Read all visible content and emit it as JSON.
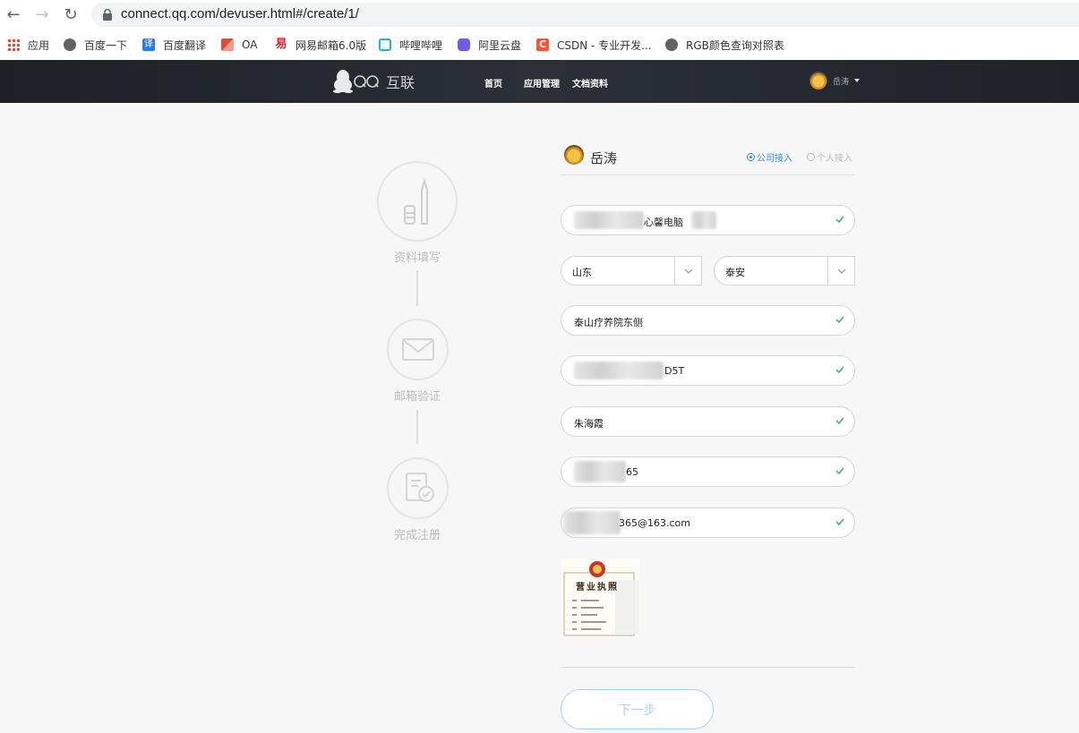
{
  "browser": {
    "url": "connect.qq.com/devuser.html#/create/1/",
    "bookmarks": [
      {
        "label": "应用",
        "icon": "apps-grid-icon"
      },
      {
        "label": "百度一下",
        "icon": "globe-icon"
      },
      {
        "label": "百度翻译",
        "icon": "translate-icon"
      },
      {
        "label": "OA",
        "icon": "oa-icon"
      },
      {
        "label": "网易邮箱6.0版",
        "icon": "netease-mail-icon"
      },
      {
        "label": "哔哩哔哩",
        "icon": "bilibili-icon"
      },
      {
        "label": "阿里云盘",
        "icon": "aliyun-drive-icon"
      },
      {
        "label": "CSDN - 专业开发...",
        "icon": "csdn-icon"
      },
      {
        "label": "RGB颜色查询对照表",
        "icon": "globe-icon"
      }
    ]
  },
  "header": {
    "logo_text": "互联",
    "nav": [
      "首页",
      "应用管理",
      "文档资料"
    ],
    "username": "岳涛"
  },
  "steps": [
    {
      "label": "资料填写",
      "state": "current"
    },
    {
      "label": "邮箱验证",
      "state": "pending"
    },
    {
      "label": "完成注册",
      "state": "pending"
    }
  ],
  "form": {
    "username": "岳涛",
    "access_types": [
      {
        "label": "公司接入",
        "selected": true
      },
      {
        "label": "个人接入",
        "selected": false
      }
    ],
    "company_name": "心馨电脑",
    "province": "山东",
    "city": "泰安",
    "address": "泰山疗养院东侧",
    "license_number": "D5T",
    "contact_name": "朱海霞",
    "phone": "65",
    "email": "365@163.com",
    "license_title": "营业执照",
    "next_label": "下一步"
  },
  "colors": {
    "accent": "#2d8fd8",
    "check": "#35b06a",
    "header_bg": "#23272d"
  }
}
